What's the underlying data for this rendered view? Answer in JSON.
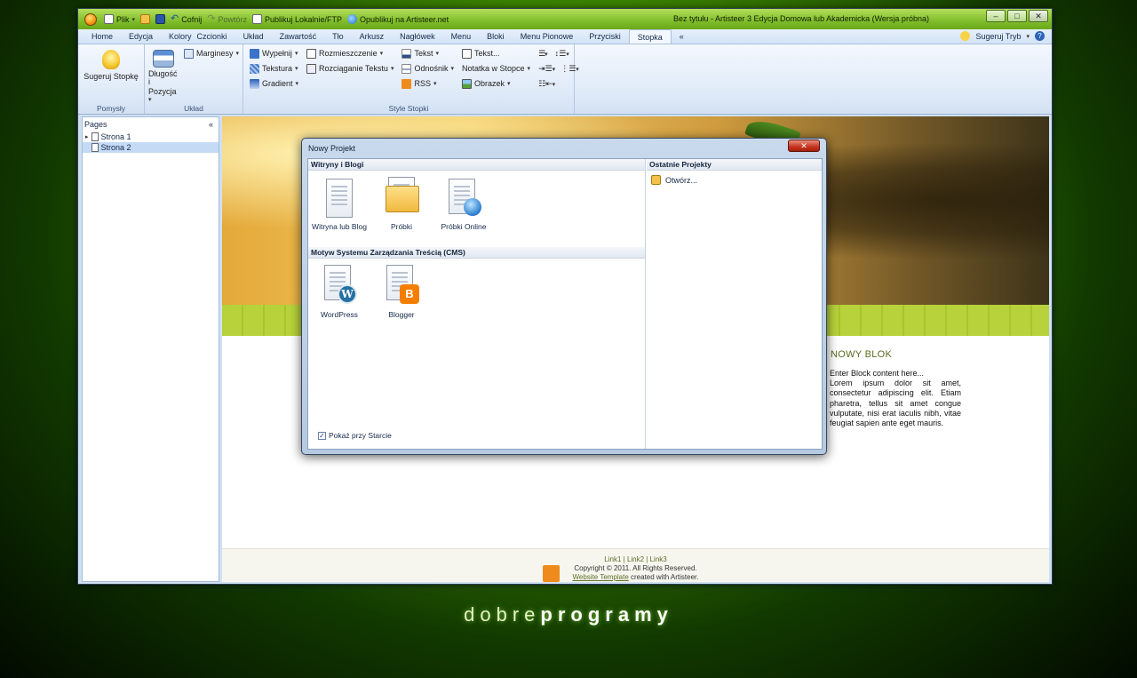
{
  "window": {
    "title": "Bez tytułu - Artisteer 3 Edycja Domowa lub Akademicka (Wersja próbna)",
    "controls": [
      "–",
      "□",
      "✕"
    ]
  },
  "quick_access": {
    "file": "Plik",
    "undo": "Cofnij",
    "redo": "Powtórz",
    "publish_local": "Publikuj Lokalnie/FTP",
    "publish_online": "Opublikuj na Artisteer.net"
  },
  "tabs": [
    "Home",
    "Edycja",
    "Kolory",
    "Czcionki",
    "Układ",
    "Zawartość",
    "Tło",
    "Arkusz",
    "Nagłówek",
    "Menu",
    "Bloki",
    "Menu Pionowe",
    "Przyciski",
    "Stopka",
    "«"
  ],
  "active_tab": "Stopka",
  "suggest_mode": "Sugeruj Tryb",
  "ribbon": {
    "ideas": {
      "button": "Sugeruj Stopkę",
      "label": "Pomysły"
    },
    "layout": {
      "length_pos_1": "Długość i",
      "length_pos_2": "Pozycja",
      "margins": "Marginesy",
      "label": "Układ"
    },
    "style": {
      "fill": "Wypełnij",
      "texture": "Tekstura",
      "gradient": "Gradient",
      "placement": "Rozmieszczenie",
      "stretch_text": "Rozciąganie Tekstu",
      "text": "Tekst",
      "link": "Odnośnik",
      "rss": "RSS",
      "text_more": "Tekst...",
      "footer_note": "Notatka w Stopce",
      "image": "Obrazek",
      "label": "Style Stopki"
    }
  },
  "pages_panel": {
    "title": "Pages",
    "collapse": "«",
    "items": [
      "Strona 1",
      "Strona 2"
    ]
  },
  "preview": {
    "block_title": "NOWY BLOK",
    "block_intro": "Enter Block content here...",
    "block_text": "Lorem ipsum dolor sit amet, consectetur adipiscing elit. Etiam pharetra, tellus sit amet congue vulputate, nisi erat iaculis nibh, vitae feugiat sapien ante eget mauris.",
    "footer_links": [
      "Link1",
      "Link2",
      "Link3"
    ],
    "copyright": "Copyright © 2011. All Rights Reserved.",
    "credit_link": "Website Template",
    "credit_rest": "created with Artisteer."
  },
  "dialog": {
    "title": "Nowy Projekt",
    "close": "✕",
    "section_sites": "Witryny i Blogi",
    "sites": [
      "Witryna lub Blog",
      "Próbki",
      "Próbki Online"
    ],
    "section_cms": "Motyw Systemu Zarządzania Treścią (CMS)",
    "cms": [
      "WordPress",
      "Blogger"
    ],
    "recent_title": "Ostatnie Projekty",
    "open": "Otwórz...",
    "show_on_start": "Pokaż przy Starcie",
    "show_on_start_checked": true
  },
  "brand": {
    "light": "dobre",
    "bold": "programy"
  }
}
